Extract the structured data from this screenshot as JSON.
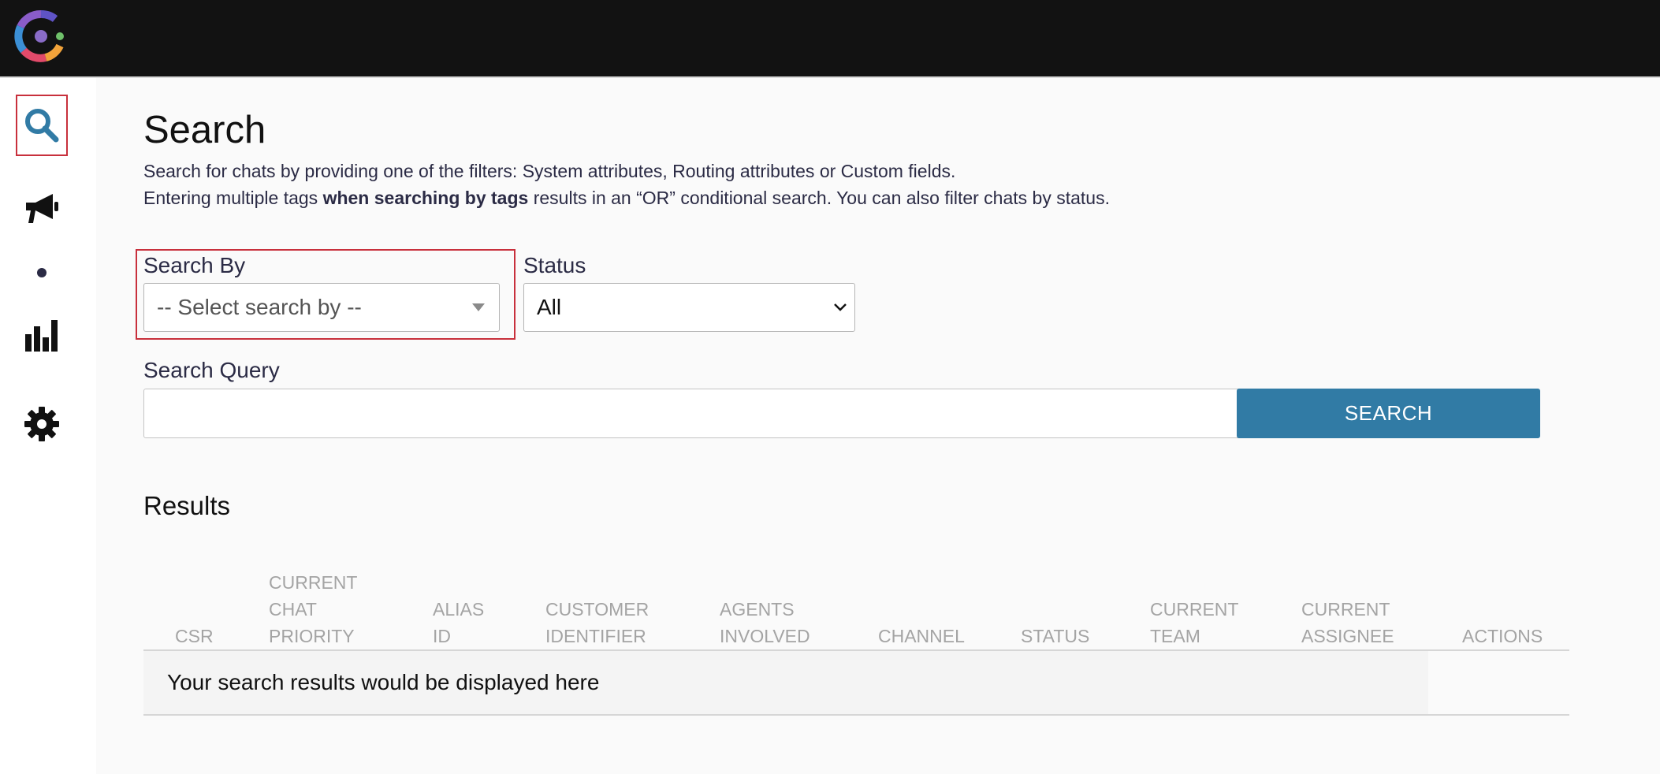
{
  "app": {
    "logo_icon": "webex-connect-logo"
  },
  "sidebar": {
    "items": [
      {
        "name": "search",
        "icon": "search-icon",
        "active": true
      },
      {
        "name": "campaigns",
        "icon": "megaphone-icon",
        "active": false
      },
      {
        "name": "indicator",
        "icon": "dot-icon",
        "active": false
      },
      {
        "name": "reports",
        "icon": "bar-chart-icon",
        "active": false
      },
      {
        "name": "settings",
        "icon": "gear-icon",
        "active": false
      }
    ]
  },
  "page": {
    "title": "Search",
    "desc_line1": "Search for chats by providing one of the filters: System attributes, Routing attributes or Custom fields.",
    "desc_line2_pre": "Entering multiple tags ",
    "desc_line2_bold": "when searching by tags",
    "desc_line2_post": " results in an “OR” conditional search. You can also filter chats by status."
  },
  "filters": {
    "search_by_label": "Search By",
    "search_by_value": "-- Select search by --",
    "status_label": "Status",
    "status_value": "All",
    "query_label": "Search Query",
    "query_value": "",
    "search_button": "SEARCH"
  },
  "results": {
    "title": "Results",
    "columns": [
      "CSR",
      "CURRENT CHAT PRIORITY",
      "ALIAS ID",
      "CUSTOMER IDENTIFIER",
      "AGENTS INVOLVED",
      "CHANNEL",
      "STATUS",
      "CURRENT TEAM",
      "CURRENT ASSIGNEE",
      "ACTIONS"
    ],
    "empty_message": "Your search results would be displayed here"
  },
  "colors": {
    "topbar": "#121212",
    "accent": "#317ba5",
    "highlight": "#c8303c"
  }
}
